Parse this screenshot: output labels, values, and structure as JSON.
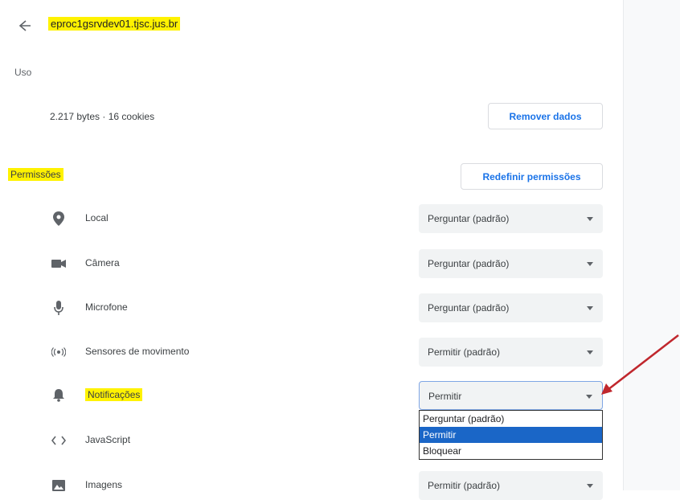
{
  "header": {
    "site": "eproc1gsrvdev01.tjsc.jus.br"
  },
  "usage": {
    "section_label": "Uso",
    "summary": "2.217 bytes · 16 cookies",
    "remove_button": "Remover dados"
  },
  "permissions": {
    "section_label": "Permissões",
    "reset_button": "Redefinir permissões",
    "items": [
      {
        "icon": "location-pin-icon",
        "label": "Local",
        "value": "Perguntar (padrão)"
      },
      {
        "icon": "camera-icon",
        "label": "Câmera",
        "value": "Perguntar (padrão)"
      },
      {
        "icon": "microphone-icon",
        "label": "Microfone",
        "value": "Perguntar (padrão)"
      },
      {
        "icon": "motion-sensors-icon",
        "label": "Sensores de movimento",
        "value": "Permitir (padrão)"
      },
      {
        "icon": "bell-icon",
        "label": "Notificações",
        "value": "Permitir"
      },
      {
        "icon": "code-icon",
        "label": "JavaScript",
        "value": ""
      },
      {
        "icon": "image-icon",
        "label": "Imagens",
        "value": "Permitir (padrão)"
      }
    ]
  },
  "notifications_dropdown": {
    "options": [
      "Perguntar (padrão)",
      "Permitir",
      "Bloquear"
    ],
    "selected": "Permitir"
  },
  "colors": {
    "highlight": "#fff200",
    "accent": "#1a73e8",
    "arrow": "#c0272d"
  }
}
